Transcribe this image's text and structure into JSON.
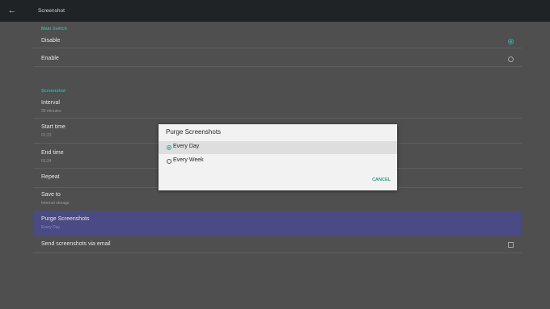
{
  "topbar": {
    "back_icon": "←",
    "title": "Screenshot"
  },
  "main_switch": {
    "header": "Main Switch",
    "options": [
      {
        "label": "Disable",
        "checked": true
      },
      {
        "label": "Enable",
        "checked": false
      }
    ]
  },
  "screenshot": {
    "header": "Screenshot",
    "items": [
      {
        "title": "Interval",
        "subtitle": "30 minutes"
      },
      {
        "title": "Start time",
        "subtitle": "01:23"
      },
      {
        "title": "End time",
        "subtitle": "01:24"
      },
      {
        "title": "Repeat",
        "subtitle": ""
      },
      {
        "title": "Save to",
        "subtitle": "Internal storage"
      },
      {
        "title": "Purge Screenshots",
        "subtitle": "Every Day"
      },
      {
        "title": "Send screenshots via email",
        "subtitle": ""
      }
    ]
  },
  "dialog": {
    "title": "Purge Screenshots",
    "options": [
      {
        "label": "Every Day",
        "checked": true
      },
      {
        "label": "Every Week",
        "checked": false
      }
    ],
    "cancel_label": "CANCEL"
  },
  "colors": {
    "accent": "#3aa196",
    "selected_row": "#4a4a85",
    "background": "#4f4f4f",
    "topbar": "#1f2325"
  },
  "icons": {
    "back": "arrow-left-icon"
  }
}
